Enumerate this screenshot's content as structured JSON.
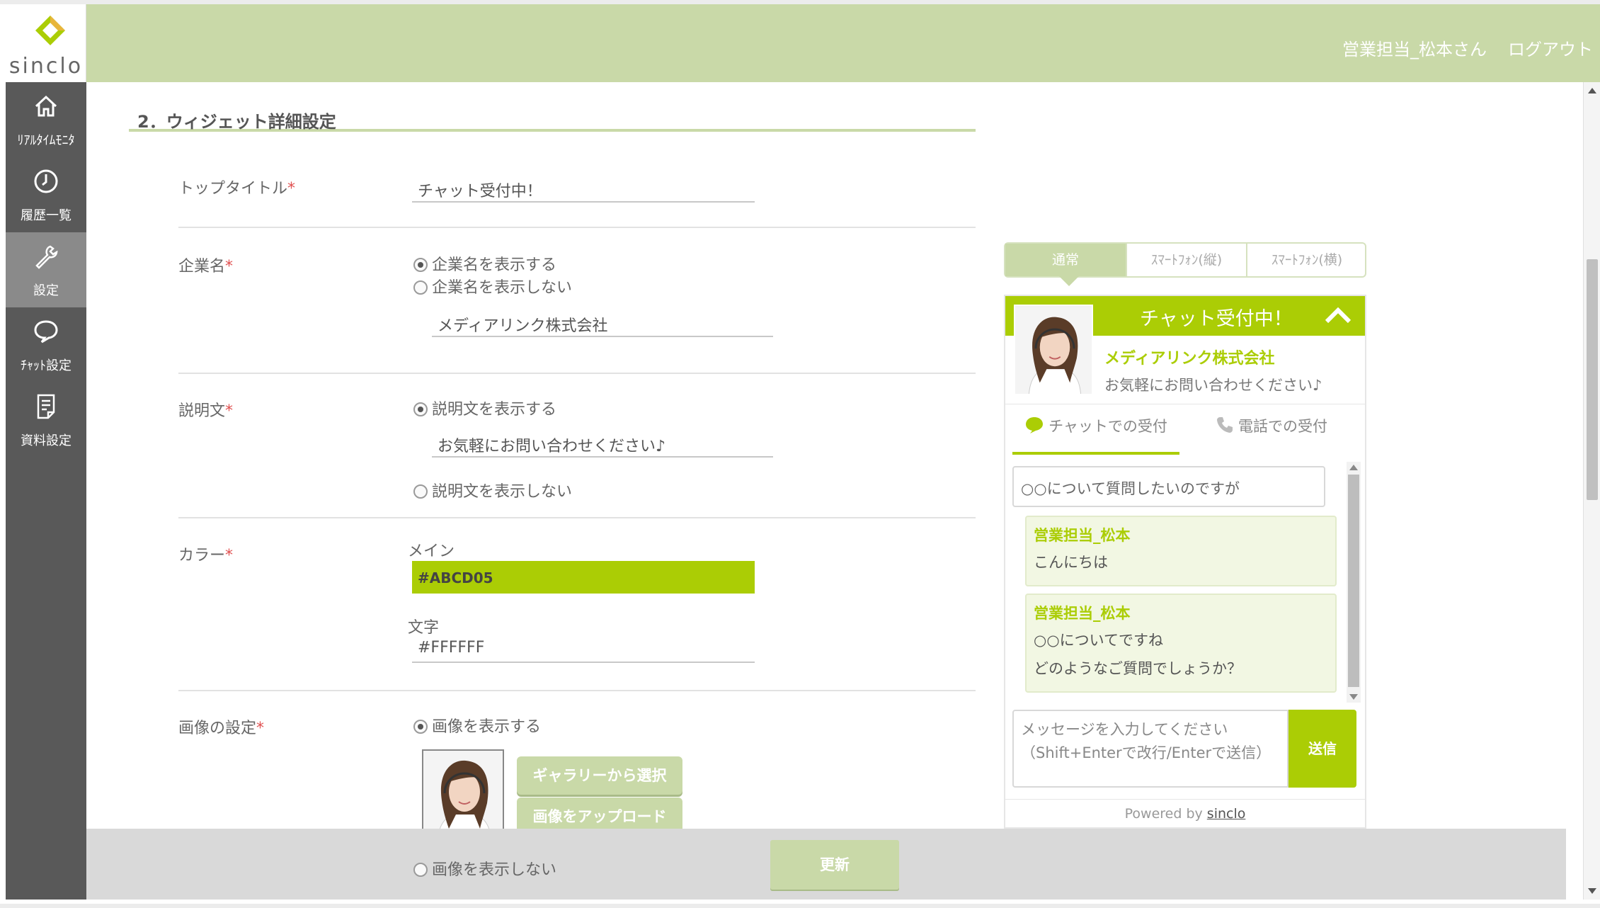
{
  "brand": {
    "name": "sinclo",
    "accent": "#c9d9a8",
    "widget_color": "#abcd05"
  },
  "header": {
    "user": "営業担当_松本さん",
    "logout": "ログアウト"
  },
  "sidebar": {
    "items": [
      {
        "label": "ﾘｱﾙﾀｲﾑﾓﾆﾀ",
        "icon": "home-icon"
      },
      {
        "label": "履歴一覧",
        "icon": "clock-icon"
      },
      {
        "label": "設定",
        "icon": "wrench-icon",
        "active": true
      },
      {
        "label": "ﾁｬｯﾄ設定",
        "icon": "speech-bubble-icon"
      },
      {
        "label": "資料設定",
        "icon": "document-icon"
      }
    ]
  },
  "section": {
    "title": "2．ウィジェット詳細設定"
  },
  "form": {
    "top_title": {
      "label": "トップタイトル",
      "value": "チャット受付中！"
    },
    "company": {
      "label": "企業名",
      "show_option": "企業名を表示する",
      "hide_option": "企業名を表示しない",
      "value": "メディアリンク株式会社"
    },
    "description": {
      "label": "説明文",
      "show_option": "説明文を表示する",
      "value": "お気軽にお問い合わせください♪",
      "hide_option": "説明文を表示しない"
    },
    "color": {
      "label": "カラー",
      "main_label": "メイン",
      "main_value": "#ABCD05",
      "text_label": "文字",
      "text_value": "#FFFFFF"
    },
    "image": {
      "label": "画像の設定",
      "show_option": "画像を表示する",
      "gallery_button": "ギャラリーから選択",
      "upload_button": "画像をアップロード",
      "hide_option": "画像を表示しない"
    },
    "required_mark": "*",
    "update_button": "更新"
  },
  "preview": {
    "tabs": [
      "通常",
      "ｽﾏｰﾄﾌｫﾝ(縦)",
      "ｽﾏｰﾄﾌｫﾝ(横)"
    ],
    "widget": {
      "title": "チャット受付中！",
      "company": "メディアリンク株式会社",
      "description": "お気軽にお問い合わせください♪",
      "subtab_chat": "チャットでの受付",
      "subtab_phone": "電話での受付",
      "question": "○○について質問したいのですが",
      "messages": [
        {
          "sender": "営業担当_松本",
          "lines": [
            "こんにちは"
          ]
        },
        {
          "sender": "営業担当_松本",
          "lines": [
            "○○についてですね",
            "どのようなご質問でしょうか？"
          ]
        }
      ],
      "input_placeholder_1": "メッセージを入力してください",
      "input_placeholder_2": "（Shift+Enterで改行/Enterで送信）",
      "send": "送信",
      "powered_prefix": "Powered by ",
      "powered_link": "sinclo"
    }
  }
}
